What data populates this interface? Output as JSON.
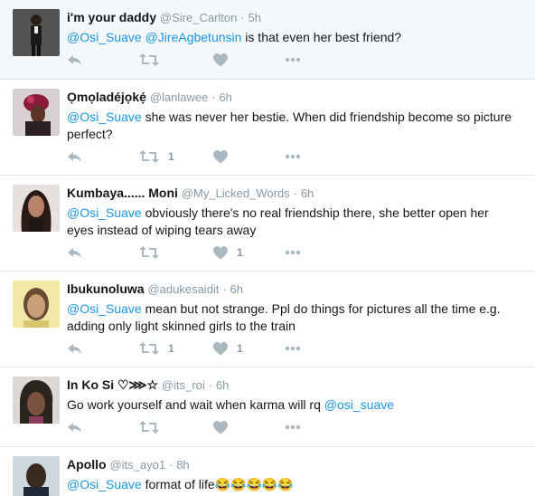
{
  "tweets": [
    {
      "name": "i'm your daddy",
      "handle": "@Sire_Carlton",
      "time": "5h",
      "mentions": [
        "@Osi_Suave",
        "@JireAgbetunsin"
      ],
      "text": " is that even her best friend?",
      "retweets": "",
      "likes": ""
    },
    {
      "name": "Ọmọladéjọkẹ́",
      "handle": "@lanlawee",
      "time": "6h",
      "mentions": [
        "@Osi_Suave"
      ],
      "text": " she was never her bestie. When did friendship become so picture perfect?",
      "retweets": "1",
      "likes": ""
    },
    {
      "name": "Kumbaya...... Moni",
      "handle": "@My_Licked_Words",
      "time": "6h",
      "mentions": [
        "@Osi_Suave"
      ],
      "text": " obviously there's no real friendship there, she better open her eyes instead of wiping tears away",
      "retweets": "",
      "likes": "1"
    },
    {
      "name": "Ibukunoluwa",
      "handle": "@adukesaidit",
      "time": "6h",
      "mentions": [
        "@Osi_Suave"
      ],
      "text": " mean but not strange. Ppl do things for pictures all the time e.g. adding only light skinned girls to the train",
      "retweets": "1",
      "likes": "1"
    },
    {
      "name": "In Ko Si ♡⋙☆",
      "handle": "@its_roi",
      "time": "6h",
      "text_before": "Go work yourself and wait when karma will rq ",
      "end_mention": "@osi_suave",
      "retweets": "",
      "likes": ""
    },
    {
      "name": "Apollo",
      "handle": "@its_ayo1",
      "time": "8h",
      "mentions": [
        "@Osi_Suave"
      ],
      "text": " format of life",
      "emojis": "😂😂😂😂😂"
    }
  ],
  "colors": {
    "link": "#1b95e0",
    "muted": "#8899a6",
    "icon": "#aab8c2",
    "highlight_bg": "#f5f8fa",
    "border": "#e1e8ed"
  },
  "icons": [
    "reply-icon",
    "retweet-icon",
    "like-icon",
    "more-icon"
  ]
}
